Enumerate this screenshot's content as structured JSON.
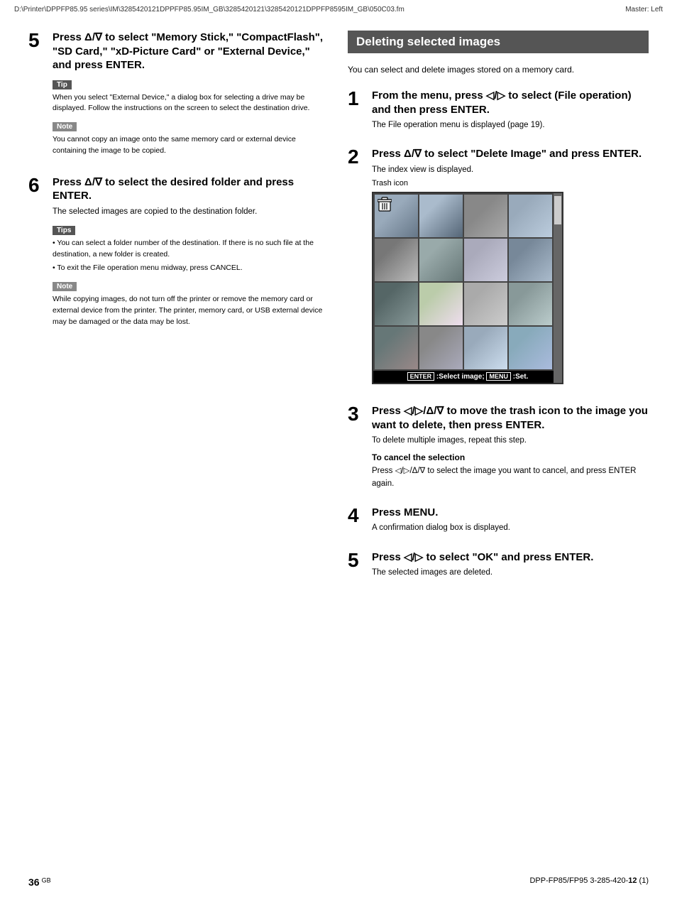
{
  "header": {
    "filepath": "D:\\Printer\\DPPFP85.95 series\\IM\\3285420121DPPFP85.95IM_GB\\3285420121\\3285420121DPPFP8595IM_GB\\050C03.fm",
    "master": "Master: Left"
  },
  "left_column": {
    "step5": {
      "number": "5",
      "title": "Press Δ/∇ to select \"Memory Stick,\" \"CompactFlash\", \"SD Card,\" \"xD-Picture Card\" or \"External Device,\" and press ENTER.",
      "tip": {
        "label": "Tip",
        "content": "When you select \"External Device,\" a dialog box for selecting a drive may be displayed. Follow the instructions on the screen to select the destination drive."
      },
      "note": {
        "label": "Note",
        "content": "You cannot copy an image onto the same memory card or external device containing the image to be copied."
      }
    },
    "step6": {
      "number": "6",
      "title": "Press Δ/∇ to select the desired folder and press ENTER.",
      "body": "The selected images are copied to the destination folder.",
      "tips": {
        "label": "Tips",
        "items": [
          "You can select a folder number of the destination. If there is no such file at the destination, a new folder is created.",
          "To exit the File operation menu midway, press CANCEL."
        ]
      },
      "note": {
        "label": "Note",
        "content": "While copying images, do not turn off the printer or remove the memory card or external device from the printer. The printer, memory card, or USB external device may be damaged or the data may be lost."
      }
    }
  },
  "right_column": {
    "section_title": "Deleting selected images",
    "intro": "You can select and delete images stored on a memory card.",
    "step1": {
      "number": "1",
      "title": "From the menu, press ◁/▷ to select  (File operation) and then press ENTER.",
      "body": "The File operation menu is displayed (page 19)."
    },
    "step2": {
      "number": "2",
      "title": "Press Δ/∇ to select \"Delete Image\" and press ENTER.",
      "body": "The index view is displayed.",
      "trash_icon_label": "Trash icon",
      "index_bar": "ENTER :Select image;  MENU :Set."
    },
    "step3": {
      "number": "3",
      "title": "Press ◁/▷/Δ/∇ to move the trash icon to the image you want to delete, then press ENTER.",
      "body": "To delete multiple images, repeat this step.",
      "cancel_heading": "To cancel the selection",
      "cancel_body": "Press ◁/▷/Δ/∇ to select the image you want to cancel, and press ENTER again."
    },
    "step4": {
      "number": "4",
      "title": "Press MENU.",
      "body": "A confirmation dialog box is displayed."
    },
    "step5": {
      "number": "5",
      "title": "Press ◁/▷ to select \"OK\" and press ENTER.",
      "body": "The selected images are deleted."
    }
  },
  "footer": {
    "page_number": "36",
    "page_suffix": "GB",
    "model": "DPP-FP85/FP95 3-285-420-",
    "model_bold": "12",
    "model_suffix": " (1)"
  }
}
